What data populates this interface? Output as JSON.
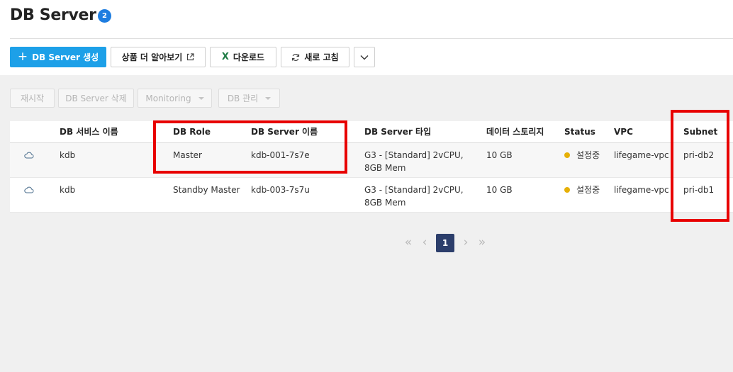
{
  "header": {
    "title": "DB Server",
    "count": "2"
  },
  "toolbar": {
    "create_label": "DB Server 생성",
    "learn_more_label": "상품 더 알아보기",
    "download_label": "다운로드",
    "refresh_label": "새로 고침"
  },
  "actions": {
    "restart": "재시작",
    "delete": "DB Server 삭제",
    "monitoring": "Monitoring",
    "db_manage": "DB 관리"
  },
  "table": {
    "columns": {
      "service_name": "DB 서비스 이름",
      "role": "DB Role",
      "server_name": "DB Server 이름",
      "server_type": "DB Server 타입",
      "storage": "데이터 스토리지",
      "status": "Status",
      "vpc": "VPC",
      "subnet": "Subnet"
    },
    "rows": [
      {
        "service_name": "kdb",
        "role": "Master",
        "server_name": "kdb-001-7s7e",
        "server_type": "G3 - [Standard] 2vCPU, 8GB Mem",
        "storage": "10 GB",
        "status": "설정중",
        "vpc": "lifegame-vpc",
        "subnet": "pri-db2"
      },
      {
        "service_name": "kdb",
        "role": "Standby Master",
        "server_name": "kdb-003-7s7u",
        "server_type": "G3 - [Standard] 2vCPU, 8GB Mem",
        "storage": "10 GB",
        "status": "설정중",
        "vpc": "lifegame-vpc",
        "subnet": "pri-db1"
      }
    ]
  },
  "pagination": {
    "current_page": "1"
  },
  "colors": {
    "primary": "#1da0e8",
    "badge": "#1e7de0",
    "status_dot": "#e6b007",
    "highlight": "#e80000",
    "page_active": "#2c3e6b"
  }
}
